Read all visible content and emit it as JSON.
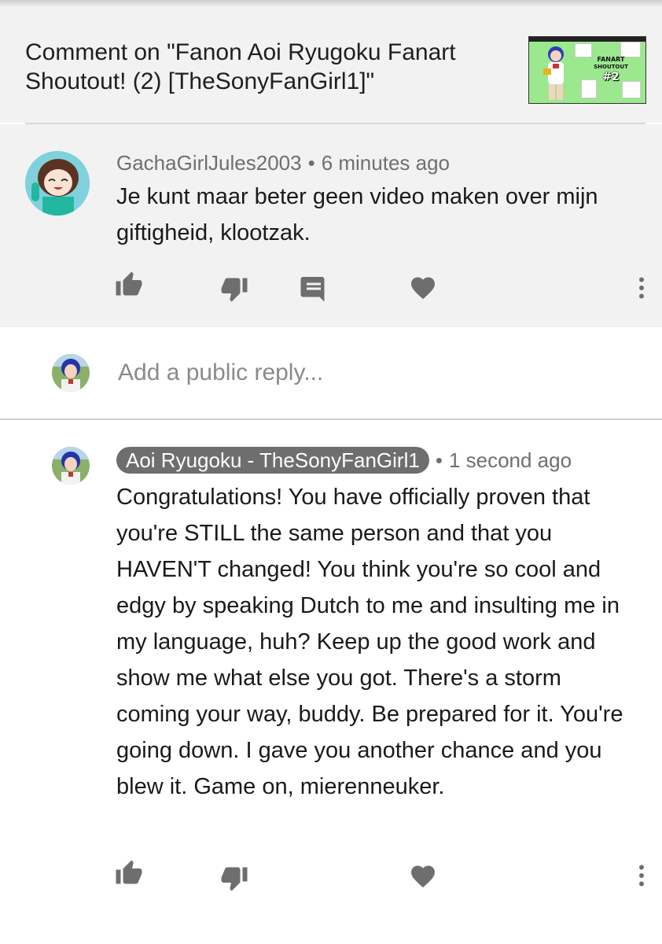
{
  "header": {
    "title": "Comment on \"Fanon Aoi Ryugoku Fanart Shoutout! (2) [TheSonyFanGirl1]\"",
    "thumbnail": {
      "line1": "FANART",
      "line2": "SHOUTOUT",
      "line3": "#2"
    }
  },
  "comment": {
    "author": "GachaGirlJules2003",
    "separator": "•",
    "time": "6 minutes ago",
    "text": "Je kunt maar beter geen video maken over mijn giftigheid, klootzak.",
    "actions": [
      "like-icon",
      "dislike-icon",
      "reply-icon",
      "heart-icon",
      "more-vert-icon"
    ]
  },
  "reply_box": {
    "placeholder": "Add a public reply..."
  },
  "reply": {
    "author": "Aoi Ryugoku - TheSonyFanGirl1",
    "separator": "•",
    "time": "1 second ago",
    "text": "Congratulations! You have officially proven that you're STILL the same person and that you HAVEN'T changed! You think you're so cool and edgy by speaking Dutch to me and insulting me in my language, huh? Keep up the good work and show me what else you got. There's a storm coming your way, buddy. Be prepared for it. You're going down. I gave you another chance and you blew it. Game on, mierenneuker.",
    "actions": [
      "like-icon",
      "dislike-icon",
      "heart-icon",
      "more-vert-icon"
    ]
  },
  "colors": {
    "panel_bg": "#f2f2f2",
    "icon": "#6e6e6e",
    "meta_text": "#6f6f6f",
    "author_badge": "#6e6e6e"
  }
}
